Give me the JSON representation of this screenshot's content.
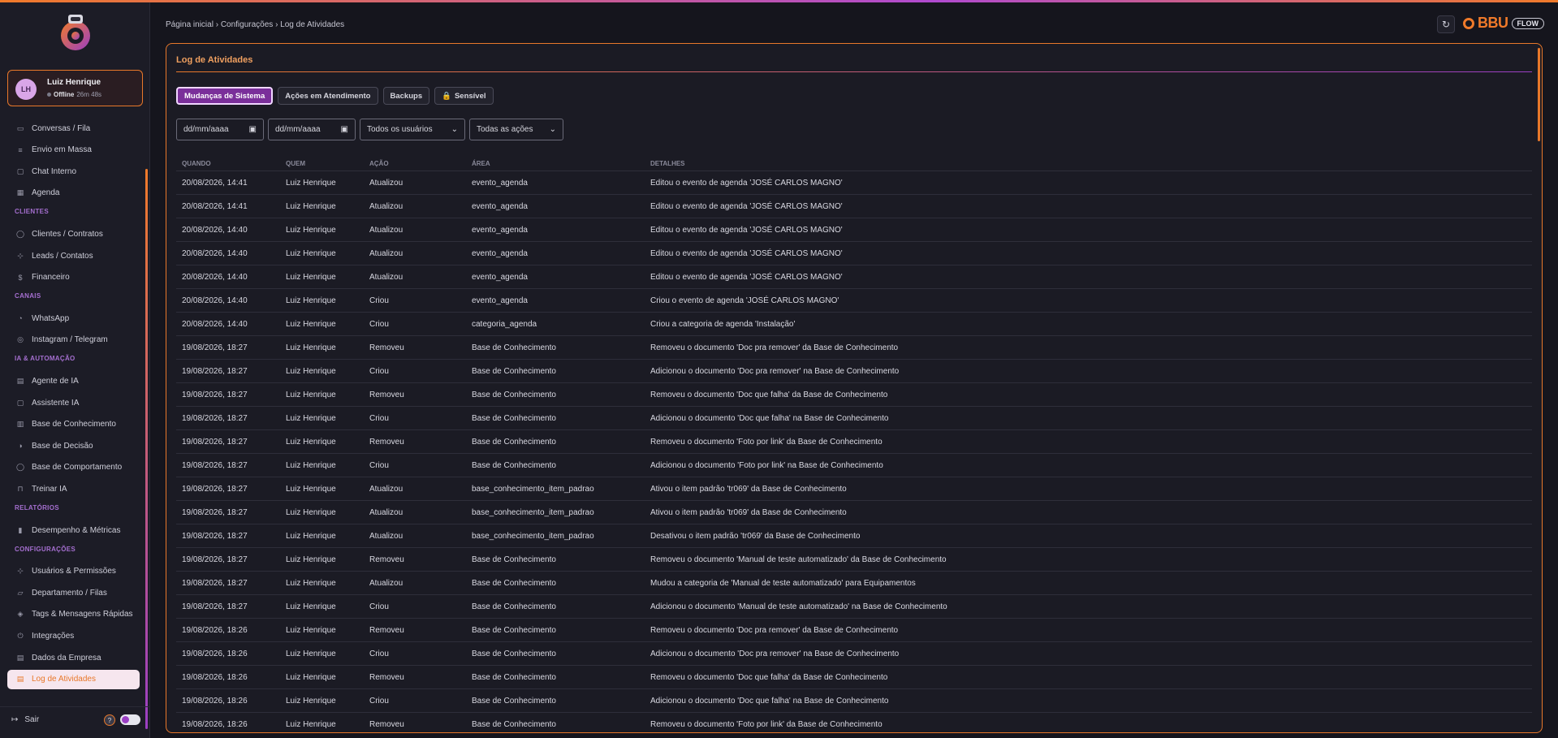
{
  "user": {
    "initials": "LH",
    "name": "Luiz Henrique",
    "status": "Offline",
    "duration": "26m 48s"
  },
  "nav": {
    "top": [
      {
        "label": "Conversas / Fila",
        "icon": "chat-icon"
      },
      {
        "label": "Envio em Massa",
        "icon": "list-icon"
      },
      {
        "label": "Chat Interno",
        "icon": "message-icon"
      },
      {
        "label": "Agenda",
        "icon": "calendar-icon"
      }
    ],
    "sections": [
      {
        "label": "CLIENTES",
        "items": [
          {
            "label": "Clientes / Contratos",
            "icon": "user-icon"
          },
          {
            "label": "Leads / Contatos",
            "icon": "user-plus-icon"
          },
          {
            "label": "Financeiro",
            "icon": "dollar-icon"
          }
        ]
      },
      {
        "label": "CANAIS",
        "items": [
          {
            "label": "WhatsApp",
            "icon": "whatsapp-icon"
          },
          {
            "label": "Instagram / Telegram",
            "icon": "instagram-icon"
          }
        ]
      },
      {
        "label": "IA & AUTOMAÇÃO",
        "items": [
          {
            "label": "Agente de IA",
            "icon": "doc-icon"
          },
          {
            "label": "Assistente IA",
            "icon": "message-icon"
          },
          {
            "label": "Base de Conhecimento",
            "icon": "book-icon"
          },
          {
            "label": "Base de Decisão",
            "icon": "decision-icon"
          },
          {
            "label": "Base de Comportamento",
            "icon": "user-icon"
          },
          {
            "label": "Treinar IA",
            "icon": "lock-icon"
          }
        ]
      },
      {
        "label": "RELATÓRIOS",
        "items": [
          {
            "label": "Desempenho & Métricas",
            "icon": "bar-chart-icon"
          }
        ]
      },
      {
        "label": "CONFIGURAÇÕES",
        "items": [
          {
            "label": "Usuários & Permissões",
            "icon": "users-icon"
          },
          {
            "label": "Departamento / Filas",
            "icon": "folder-icon"
          },
          {
            "label": "Tags & Mensagens Rápidas",
            "icon": "tag-icon"
          },
          {
            "label": "Integrações",
            "icon": "plug-icon"
          },
          {
            "label": "Dados da Empresa",
            "icon": "building-icon"
          },
          {
            "label": "Log de Atividades",
            "icon": "log-icon",
            "active": true
          }
        ]
      }
    ],
    "logout": "Sair",
    "help": "?"
  },
  "header": {
    "breadcrumb": "Página inicial › Configurações › Log de Atividades",
    "brand_word": "BBU",
    "brand_tag": "FLOW"
  },
  "panel": {
    "title": "Log de Atividades",
    "tabs": [
      {
        "label": "Mudanças de Sistema",
        "active": true
      },
      {
        "label": "Ações em Atendimento"
      },
      {
        "label": "Backups"
      },
      {
        "label": "Sensível",
        "icon": "lock-icon"
      }
    ],
    "filters": {
      "date_from": "dd/mm/aaaa",
      "date_to": "dd/mm/aaaa",
      "users": "Todos os usuários",
      "actions": "Todas as ações"
    },
    "columns": [
      "QUANDO",
      "QUEM",
      "AÇÃO",
      "ÁREA",
      "DETALHES"
    ],
    "rows": [
      [
        "20/08/2026, 14:41",
        "Luiz Henrique",
        "Atualizou",
        "evento_agenda",
        "Editou o evento de agenda 'JOSÉ CARLOS MAGNO'"
      ],
      [
        "20/08/2026, 14:41",
        "Luiz Henrique",
        "Atualizou",
        "evento_agenda",
        "Editou o evento de agenda 'JOSÉ CARLOS MAGNO'"
      ],
      [
        "20/08/2026, 14:40",
        "Luiz Henrique",
        "Atualizou",
        "evento_agenda",
        "Editou o evento de agenda 'JOSÉ CARLOS MAGNO'"
      ],
      [
        "20/08/2026, 14:40",
        "Luiz Henrique",
        "Atualizou",
        "evento_agenda",
        "Editou o evento de agenda 'JOSÉ CARLOS MAGNO'"
      ],
      [
        "20/08/2026, 14:40",
        "Luiz Henrique",
        "Atualizou",
        "evento_agenda",
        "Editou o evento de agenda 'JOSÉ CARLOS MAGNO'"
      ],
      [
        "20/08/2026, 14:40",
        "Luiz Henrique",
        "Criou",
        "evento_agenda",
        "Criou o evento de agenda 'JOSÉ CARLOS MAGNO'"
      ],
      [
        "20/08/2026, 14:40",
        "Luiz Henrique",
        "Criou",
        "categoria_agenda",
        "Criou a categoria de agenda 'Instalação'"
      ],
      [
        "19/08/2026, 18:27",
        "Luiz Henrique",
        "Removeu",
        "Base de Conhecimento",
        "Removeu o documento 'Doc pra remover' da Base de Conhecimento"
      ],
      [
        "19/08/2026, 18:27",
        "Luiz Henrique",
        "Criou",
        "Base de Conhecimento",
        "Adicionou o documento 'Doc pra remover' na Base de Conhecimento"
      ],
      [
        "19/08/2026, 18:27",
        "Luiz Henrique",
        "Removeu",
        "Base de Conhecimento",
        "Removeu o documento 'Doc que falha' da Base de Conhecimento"
      ],
      [
        "19/08/2026, 18:27",
        "Luiz Henrique",
        "Criou",
        "Base de Conhecimento",
        "Adicionou o documento 'Doc que falha' na Base de Conhecimento"
      ],
      [
        "19/08/2026, 18:27",
        "Luiz Henrique",
        "Removeu",
        "Base de Conhecimento",
        "Removeu o documento 'Foto por link' da Base de Conhecimento"
      ],
      [
        "19/08/2026, 18:27",
        "Luiz Henrique",
        "Criou",
        "Base de Conhecimento",
        "Adicionou o documento 'Foto por link' na Base de Conhecimento"
      ],
      [
        "19/08/2026, 18:27",
        "Luiz Henrique",
        "Atualizou",
        "base_conhecimento_item_padrao",
        "Ativou o item padrão 'tr069' da Base de Conhecimento"
      ],
      [
        "19/08/2026, 18:27",
        "Luiz Henrique",
        "Atualizou",
        "base_conhecimento_item_padrao",
        "Ativou o item padrão 'tr069' da Base de Conhecimento"
      ],
      [
        "19/08/2026, 18:27",
        "Luiz Henrique",
        "Atualizou",
        "base_conhecimento_item_padrao",
        "Desativou o item padrão 'tr069' da Base de Conhecimento"
      ],
      [
        "19/08/2026, 18:27",
        "Luiz Henrique",
        "Removeu",
        "Base de Conhecimento",
        "Removeu o documento 'Manual de teste automatizado' da Base de Conhecimento"
      ],
      [
        "19/08/2026, 18:27",
        "Luiz Henrique",
        "Atualizou",
        "Base de Conhecimento",
        "Mudou a categoria de 'Manual de teste automatizado' para Equipamentos"
      ],
      [
        "19/08/2026, 18:27",
        "Luiz Henrique",
        "Criou",
        "Base de Conhecimento",
        "Adicionou o documento 'Manual de teste automatizado' na Base de Conhecimento"
      ],
      [
        "19/08/2026, 18:26",
        "Luiz Henrique",
        "Removeu",
        "Base de Conhecimento",
        "Removeu o documento 'Doc pra remover' da Base de Conhecimento"
      ],
      [
        "19/08/2026, 18:26",
        "Luiz Henrique",
        "Criou",
        "Base de Conhecimento",
        "Adicionou o documento 'Doc pra remover' na Base de Conhecimento"
      ],
      [
        "19/08/2026, 18:26",
        "Luiz Henrique",
        "Removeu",
        "Base de Conhecimento",
        "Removeu o documento 'Doc que falha' da Base de Conhecimento"
      ],
      [
        "19/08/2026, 18:26",
        "Luiz Henrique",
        "Criou",
        "Base de Conhecimento",
        "Adicionou o documento 'Doc que falha' na Base de Conhecimento"
      ],
      [
        "19/08/2026, 18:26",
        "Luiz Henrique",
        "Removeu",
        "Base de Conhecimento",
        "Removeu o documento 'Foto por link' da Base de Conhecimento"
      ]
    ]
  },
  "colors": {
    "accent": "#e8782a",
    "purple": "#9b3fc4",
    "bg": "#15151d"
  }
}
